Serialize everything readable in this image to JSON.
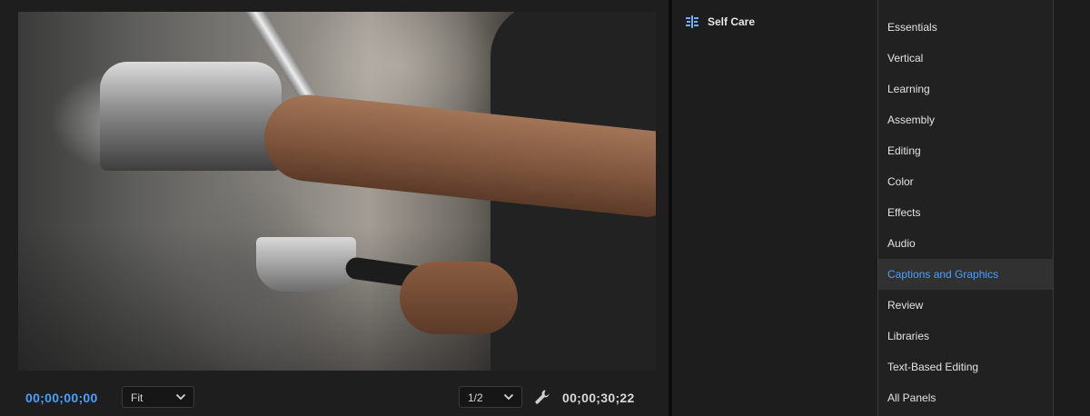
{
  "monitor": {
    "current_timecode": "00;00;00;00",
    "zoom_level": "Fit",
    "playback_resolution": "1/2",
    "duration_timecode": "00;00;30;22",
    "settings_icon": "wrench-icon"
  },
  "project": {
    "sequence_name": "Self Care",
    "sequence_icon": "sequence-icon"
  },
  "workspaces": {
    "items": [
      {
        "label": "Essentials"
      },
      {
        "label": "Vertical"
      },
      {
        "label": "Learning"
      },
      {
        "label": "Assembly"
      },
      {
        "label": "Editing"
      },
      {
        "label": "Color"
      },
      {
        "label": "Effects"
      },
      {
        "label": "Audio"
      },
      {
        "label": "Captions and Graphics"
      },
      {
        "label": "Review"
      },
      {
        "label": "Libraries"
      },
      {
        "label": "Text-Based Editing"
      },
      {
        "label": "All Panels"
      }
    ],
    "active_item": "Captions and Graphics"
  },
  "colors": {
    "accent": "#4a9eff",
    "timecode_current": "#4aa0ff",
    "panel_background": "#1d1d1d"
  }
}
